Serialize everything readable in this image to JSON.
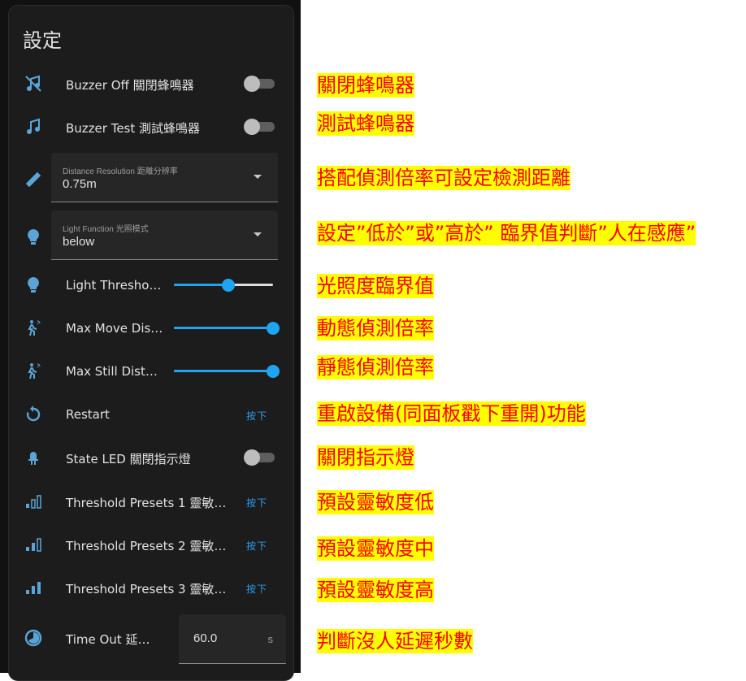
{
  "card": {
    "title": "設定"
  },
  "rows": {
    "buzzer_off": {
      "label": "Buzzer Off 關閉蜂鳴器",
      "icon": "music-off-icon",
      "state": "off"
    },
    "buzzer_test": {
      "label": "Buzzer Test 測試蜂鳴器",
      "icon": "music-note-icon",
      "state": "off"
    },
    "distance_resolution": {
      "label": "Distance Resolution 距離分辨率",
      "value": "0.75m",
      "icon": "ruler-icon"
    },
    "light_function": {
      "label": "Light Function 光照模式",
      "value": "below",
      "icon": "lightbulb-icon"
    },
    "light_threshold": {
      "label": "Light Thresho…",
      "icon": "lightbulb-icon",
      "level": 0.55
    },
    "max_move": {
      "label": "Max Move Dis…",
      "icon": "motion-sensor-icon",
      "level": 1.0
    },
    "max_still": {
      "label": "Max Still Dist…",
      "icon": "motion-sensor-icon",
      "level": 1.0
    },
    "restart": {
      "label": "Restart",
      "icon": "restart-icon",
      "button": "按下"
    },
    "state_led": {
      "label": "State LED 關閉指示燈",
      "icon": "led-icon",
      "state": "off"
    },
    "preset1": {
      "label": "Threshold Presets 1 靈敏…",
      "icon": "signal-low-icon",
      "button": "按下"
    },
    "preset2": {
      "label": "Threshold Presets 2 靈敏…",
      "icon": "signal-medium-icon",
      "button": "按下"
    },
    "preset3": {
      "label": "Threshold Presets 3 靈敏…",
      "icon": "signal-high-icon",
      "button": "按下"
    },
    "timeout": {
      "label": "Time Out 延…",
      "icon": "timer-icon",
      "value": "60.0",
      "unit": "s"
    }
  },
  "notes": [
    "關閉蜂鳴器",
    "測試蜂鳴器",
    "搭配偵測倍率可設定檢測距離",
    "設定”低於”或”高於” 臨界值判斷”人在感應”",
    "光照度臨界值",
    "動態偵測倍率",
    "靜態偵測倍率",
    "重啟設備(同面板戳下重開)功能",
    "關閉指示燈",
    "預設靈敏度低",
    "預設靈敏度中",
    "預設靈敏度高",
    "判斷沒人延遲秒數"
  ],
  "colors": {
    "accent": "#1ea4f0",
    "note_text": "#ff0000",
    "note_bg": "#ffff00",
    "icon": "#5aa5d8"
  }
}
